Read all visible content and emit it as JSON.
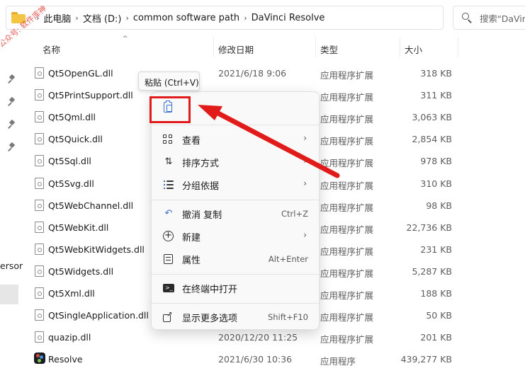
{
  "address": {
    "crumbs": [
      "此电脑",
      "文档 (D:)",
      "common software path",
      "DaVinci Resolve"
    ],
    "separator": "›"
  },
  "search": {
    "text": "搜索\"DaVinci Resolve\""
  },
  "watermark": "公众号: 软件库神",
  "nav": {
    "clipped_label": "ersor"
  },
  "columns": {
    "name": "名称",
    "date": "修改日期",
    "type": "类型",
    "size": "大小",
    "sort_glyph": "^"
  },
  "files": [
    {
      "name": "Qt5OpenGL.dll",
      "date": "2021/6/18 9:06",
      "type": "应用程序扩展",
      "size": "318 KB",
      "icon": "dll-file-icon"
    },
    {
      "name": "Qt5PrintSupport.dll",
      "date": "",
      "type": "应用程序扩展",
      "size": "311 KB",
      "icon": "dll-file-icon"
    },
    {
      "name": "Qt5Qml.dll",
      "date": "",
      "type": "应用程序扩展",
      "size": "3,063 KB",
      "icon": "dll-file-icon"
    },
    {
      "name": "Qt5Quick.dll",
      "date": "",
      "type": "应用程序扩展",
      "size": "2,854 KB",
      "icon": "dll-file-icon"
    },
    {
      "name": "Qt5Sql.dll",
      "date": "",
      "type": "应用程序扩展",
      "size": "978 KB",
      "icon": "dll-file-icon"
    },
    {
      "name": "Qt5Svg.dll",
      "date": "",
      "type": "应用程序扩展",
      "size": "310 KB",
      "icon": "dll-file-icon"
    },
    {
      "name": "Qt5WebChannel.dll",
      "date": "",
      "type": "应用程序扩展",
      "size": "98 KB",
      "icon": "dll-file-icon"
    },
    {
      "name": "Qt5WebKit.dll",
      "date": "",
      "type": "应用程序扩展",
      "size": "22,736 KB",
      "icon": "dll-file-icon"
    },
    {
      "name": "Qt5WebKitWidgets.dll",
      "date": "",
      "type": "应用程序扩展",
      "size": "231 KB",
      "icon": "dll-file-icon"
    },
    {
      "name": "Qt5Widgets.dll",
      "date": "",
      "type": "应用程序扩展",
      "size": "5,287 KB",
      "icon": "dll-file-icon"
    },
    {
      "name": "Qt5Xml.dll",
      "date": "",
      "type": "应用程序扩展",
      "size": "188 KB",
      "icon": "dll-file-icon"
    },
    {
      "name": "QtSingleApplication.dll",
      "date": "",
      "type": "应用程序扩展",
      "size": "50 KB",
      "icon": "dll-file-icon"
    },
    {
      "name": "quazip.dll",
      "date": "2020/12/20 11:25",
      "type": "应用程序扩展",
      "size": "201 KB",
      "icon": "dll-file-icon"
    },
    {
      "name": "Resolve",
      "date": "2021/6/30 10:36",
      "type": "应用程序",
      "size": "439,277 KB",
      "icon": "resolve-app-icon"
    }
  ],
  "tooltip": {
    "text": "粘贴 (Ctrl+V)"
  },
  "context_menu": {
    "paste_icon": "clipboard-paste-icon",
    "items": [
      {
        "label": "查看",
        "shortcut": "",
        "submenu": "›",
        "icon": "view-grid-icon"
      },
      {
        "label": "排序方式",
        "shortcut": "",
        "submenu": "›",
        "icon": "sort-icon"
      },
      {
        "label": "分组依据",
        "shortcut": "",
        "submenu": "›",
        "icon": "group-list-icon"
      },
      {
        "label": "撤消 复制",
        "shortcut": "Ctrl+Z",
        "submenu": "",
        "icon": "undo-icon"
      },
      {
        "label": "新建",
        "shortcut": "",
        "submenu": "›",
        "icon": "new-plus-icon"
      },
      {
        "label": "属性",
        "shortcut": "Alt+Enter",
        "submenu": "",
        "icon": "properties-icon"
      },
      {
        "label": "在终端中打开",
        "shortcut": "",
        "submenu": "",
        "icon": "terminal-icon"
      },
      {
        "label": "显示更多选项",
        "shortcut": "Shift+F10",
        "submenu": "",
        "icon": "show-more-icon"
      }
    ]
  },
  "annotation_color": "#e11a1a"
}
